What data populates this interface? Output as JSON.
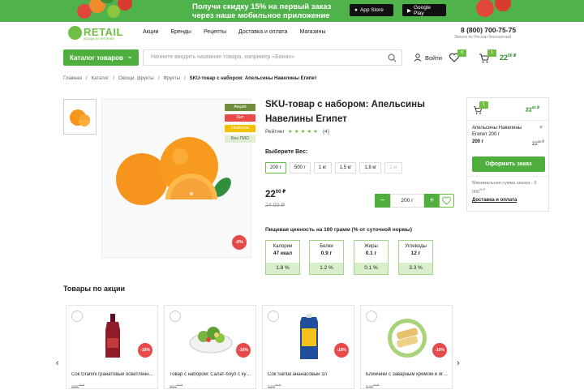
{
  "banner": {
    "line1": "Получи скидку 15% на первый заказ",
    "line2": "через наше мобильное приложение",
    "app_store": "App Store",
    "google_play": "Google Play"
  },
  "logo": {
    "word": "RETAIL",
    "sub": "продукты питания"
  },
  "nav": [
    "Акции",
    "Бренды",
    "Рецепты",
    "Доставка и оплата",
    "Магазины"
  ],
  "phone": {
    "number": "8 (800) 700-75-75",
    "note": "Звонок по России бесплатный"
  },
  "header": {
    "catalog": "Каталог товаров",
    "search_placeholder": "Начните вводить название товара, например «Банан»",
    "login": "Войти",
    "fav_count": "0",
    "cart_count": "1",
    "cart_price_main": "22",
    "cart_price_sup": "00 ₽"
  },
  "breadcrumbs": [
    "Главная",
    "Каталог",
    "Овощи, фрукты",
    "Фрукты",
    "SKU-товар с набором: Апельсины Навелины Египет"
  ],
  "product": {
    "tags": [
      "Акция",
      "Хит",
      "Новинка",
      "Без ГМО"
    ],
    "discount": "-6%",
    "title": "SKU-товар с набором: Апельсины Навелины Египет",
    "rating_label": "Рейтинг",
    "rating_stars": "★★★★★",
    "rating_count": "(4)",
    "weight_label": "Выберите Вес:",
    "weights": [
      "200 г",
      "500 г",
      "1 кг",
      "1,5 кг",
      "1,8 кг",
      "2 кг"
    ],
    "price_main": "22",
    "price_sup": "00 ₽",
    "old_price": "24 00 ₽",
    "qty_minus": "−",
    "qty_value": "200 г",
    "qty_plus": "+",
    "nutrition_title": "Пищевая ценность на 100 грамм (% от суточной нормы)",
    "nutrition": [
      {
        "label": "Калории",
        "value": "47 ккал",
        "pct": "1.8 %"
      },
      {
        "label": "Белки",
        "value": "0.9 г",
        "pct": "1.2 %"
      },
      {
        "label": "Жиры",
        "value": "0.1 г",
        "pct": "0.1 %"
      },
      {
        "label": "Углеводы",
        "value": "12 г",
        "pct": "3.3 %"
      }
    ]
  },
  "cart": {
    "count": "1",
    "total_main": "22",
    "total_sup": "00 ₽",
    "item_name": "Апельсины Навелины Египет 200 г",
    "item_weight": "200 г",
    "item_price_main": "22",
    "item_price_sup": "00 ₽",
    "remove": "×",
    "order_button": "Оформить заказ",
    "min_text": "Минимальная сумма заказа - 5 000",
    "min_sup": "00 ₽",
    "delivery_link": "Доставка и оплата"
  },
  "promo": {
    "title": "Товары по акции",
    "prev": "‹",
    "next": "›",
    "items": [
      {
        "name": "Сок Granini гранатовый осветленный 1л",
        "discount": "-10%",
        "old_main": "395",
        "old_sup": "00 ₽"
      },
      {
        "name": "Товар с набором: Салат-боул с курицей",
        "discount": "-10%",
        "old_main": "356",
        "old_sup": "00 ₽"
      },
      {
        "name": "Сок Santal ананасовый 1л",
        "discount": "-10%",
        "old_main": "126",
        "old_sup": "00 ₽"
      },
      {
        "name": "Блинчики с заварным кремом и ягодами",
        "discount": "-10%",
        "old_main": "149",
        "old_sup": "00 ₽"
      }
    ]
  },
  "colors": {
    "accent": "#4fae3e",
    "accent_light": "#6fbe44",
    "discount": "#e84a4a"
  }
}
